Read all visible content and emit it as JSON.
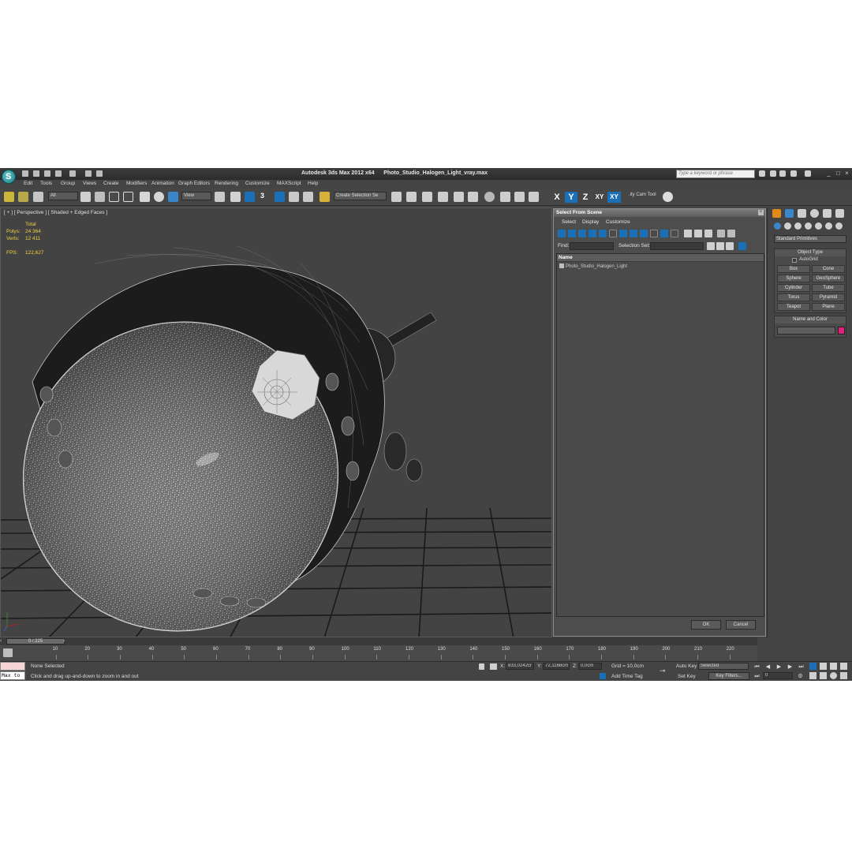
{
  "title_bar": {
    "app_title": "Autodesk 3ds Max  2012 x64",
    "file_name": "Photo_Studio_Halogen_Light_vray.max",
    "search_placeholder": "Type a keyword or phrase"
  },
  "menu": [
    "Edit",
    "Tools",
    "Group",
    "Views",
    "Create",
    "Modifiers",
    "Animation",
    "Graph Editors",
    "Rendering",
    "Customize",
    "MAXScript",
    "Help"
  ],
  "toolbar": {
    "filter_combo": "All",
    "ref_coord_combo": "View",
    "snap_label": "3",
    "selection_set_combo": "Create Selection Se",
    "axis_x": "X",
    "axis_y": "Y",
    "axis_z": "Z",
    "axis_xy": "XY",
    "axis_xy2": "XY",
    "utility_label": ".ity Cam Tool",
    "accent_color": "#1a6fb6"
  },
  "viewport": {
    "label": "[ + ] [ Perspective ] [ Shaded + Edged Faces ]",
    "stats": {
      "total_label": "Total",
      "polys_label": "Polys:",
      "polys_value": "24 364",
      "verts_label": "Verts:",
      "verts_value": "12 411",
      "fps_label": "FPS:",
      "fps_value": "122,627"
    }
  },
  "select_dialog": {
    "title": "Select From Scene",
    "tabs": [
      "Select",
      "Display",
      "Customize"
    ],
    "find_label": "Find:",
    "selection_set_label": "Selection Set:",
    "column_name": "Name",
    "items": [
      "Photo_Studio_Halogen_Light"
    ],
    "ok_label": "OK",
    "cancel_label": "Cancel"
  },
  "command_panel": {
    "dropdown": "Standard Primitives",
    "object_type_title": "Object Type",
    "autogrid_label": "AutoGrid",
    "buttons": [
      "Box",
      "Cone",
      "Sphere",
      "GeoSphere",
      "Cylinder",
      "Tube",
      "Torus",
      "Pyramid",
      "Teapot",
      "Plane"
    ],
    "name_color_title": "Name and Color",
    "object_color": "#e0207a"
  },
  "timeline": {
    "frame_display": "0 / 225",
    "ticks": [
      "10",
      "20",
      "30",
      "40",
      "50",
      "60",
      "70",
      "80",
      "90",
      "100",
      "110",
      "120",
      "130",
      "140",
      "150",
      "160",
      "170",
      "180",
      "190",
      "200",
      "210",
      "220"
    ]
  },
  "status": {
    "maxscript_label": "Max to",
    "selection_status": "None Selected",
    "prompt": "Click and drag up-and-down to zoom in and out",
    "x_label": "X:",
    "x_value": "833,0242cr",
    "y_label": "Y:",
    "y_value": "72,1168cm",
    "z_label": "Z:",
    "z_value": "0,0cm",
    "grid": "Grid = 10,0cm",
    "add_time_tag": "Add Time Tag",
    "auto_key": "Auto Key",
    "selected_combo": "Selected",
    "set_key": "Set Key",
    "key_filters": "Key Filters...",
    "frame_field": "0"
  }
}
